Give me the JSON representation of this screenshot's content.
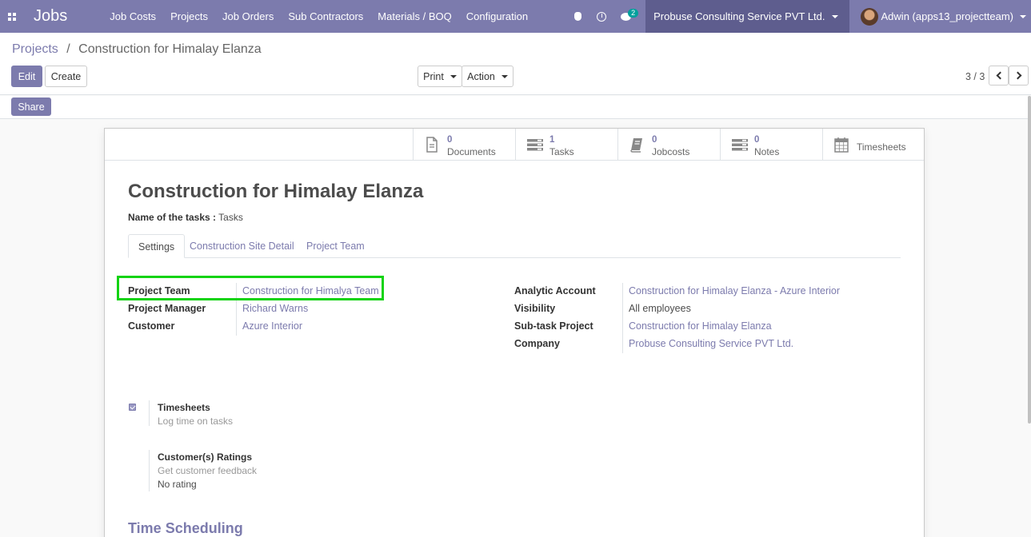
{
  "navbar": {
    "app_title": "Jobs",
    "menu": [
      "Job Costs",
      "Projects",
      "Job Orders",
      "Sub Contractors",
      "Materials / BOQ",
      "Configuration"
    ],
    "chat_count": "2",
    "company": "Probuse Consulting Service PVT Ltd.",
    "user": "Adwin (apps13_projectteam)"
  },
  "breadcrumb": {
    "parent": "Projects",
    "separator": "/",
    "current": "Construction for Himalay Elanza"
  },
  "actions": {
    "edit": "Edit",
    "create": "Create",
    "print": "Print",
    "action": "Action",
    "share": "Share"
  },
  "pager": {
    "value": "3 / 3"
  },
  "stat_buttons": [
    {
      "value": "0",
      "label": "Documents",
      "icon": "document-icon"
    },
    {
      "value": "1",
      "label": "Tasks",
      "icon": "tasks-icon"
    },
    {
      "value": "0",
      "label": "Jobcosts",
      "icon": "book-icon"
    },
    {
      "value": "0",
      "label": "Notes",
      "icon": "notes-icon"
    },
    {
      "value": "",
      "label": "Timesheets",
      "icon": "calendar-icon"
    }
  ],
  "record": {
    "title": "Construction for Himalay Elanza",
    "tasks_label": "Name of the tasks :",
    "tasks_value": "Tasks"
  },
  "tabs": [
    "Settings",
    "Construction Site Detail",
    "Project Team"
  ],
  "left_fields": [
    {
      "label": "Project Team",
      "value": "Construction for Himalya Team"
    },
    {
      "label": "Project Manager",
      "value": "Richard Warns"
    },
    {
      "label": "Customer",
      "value": "Azure Interior"
    }
  ],
  "right_fields": [
    {
      "label": "Analytic Account",
      "value": "Construction for Himalay Elanza - Azure Interior"
    },
    {
      "label": "Visibility",
      "value": "All employees"
    },
    {
      "label": "Sub-task Project",
      "value": "Construction for Himalay Elanza"
    },
    {
      "label": "Company",
      "value": "Probuse Consulting Service PVT Ltd."
    }
  ],
  "settings": {
    "timesheets_title": "Timesheets",
    "timesheets_desc": "Log time on tasks",
    "timesheets_checked": true,
    "ratings_title": "Customer(s) Ratings",
    "ratings_desc": "Get customer feedback",
    "ratings_value": "No rating"
  },
  "section": {
    "time_scheduling": "Time Scheduling"
  },
  "colors": {
    "brand": "#7c7bad",
    "highlight": "#13d313"
  }
}
